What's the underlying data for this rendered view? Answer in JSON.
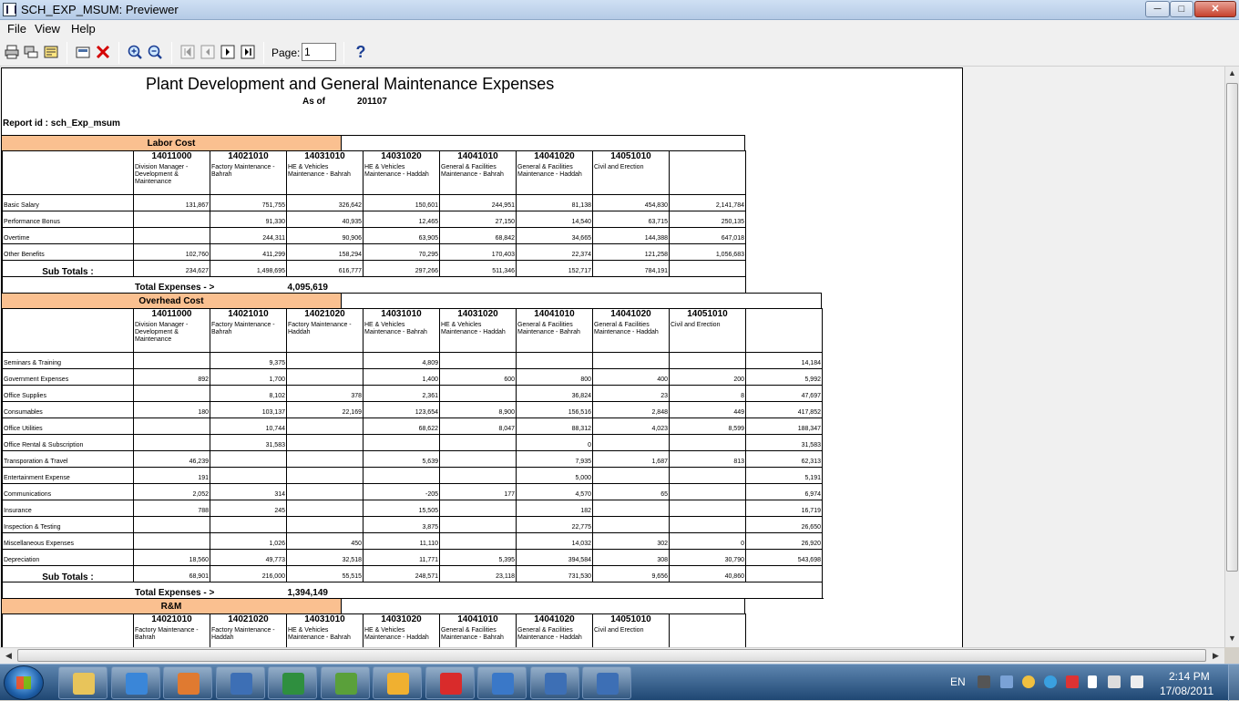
{
  "window": {
    "title": "SCH_EXP_MSUM: Previewer",
    "min": "─",
    "max": "□",
    "close": "✕"
  },
  "menu": [
    "File",
    "View",
    "Help"
  ],
  "toolbar": {
    "page_label": "Page:",
    "page_value": "1",
    "help": "?"
  },
  "icons": {
    "print": "printer-icon",
    "print_setup": "print-setup-icon",
    "export": "export-icon",
    "close_preview": "close-icon",
    "zoom_in": "zoom-in-icon",
    "zoom_out": "zoom-out-icon",
    "first": "first-page-icon",
    "prev": "prev-page-icon",
    "next": "next-page-icon",
    "last": "last-page-icon"
  },
  "report": {
    "title": "Plant Development and General Maintenance Expenses",
    "asof_label": "As of",
    "asof_value": "201107",
    "report_id": "Report id : sch_Exp_msum",
    "subtotal_label": "Sub Totals :",
    "total_label": "Total Expenses - >",
    "sections": [
      {
        "name": "Labor Cost",
        "columns": [
          {
            "code": "14011000",
            "desc": "Division Manager - Development & Maintenance"
          },
          {
            "code": "14021010",
            "desc": "Factory Maintenance - Bahrah"
          },
          {
            "code": "14031010",
            "desc": "HE & Vehicles Maintenance - Bahrah"
          },
          {
            "code": "14031020",
            "desc": "HE & Vehicles Maintenance - Haddah"
          },
          {
            "code": "14041010",
            "desc": "General & Facilities Maintenance - Bahrah"
          },
          {
            "code": "14041020",
            "desc": "General & Facilities Maintenance - Haddah"
          },
          {
            "code": "14051010",
            "desc": "Civil and Erection"
          },
          {
            "code": "",
            "desc": ""
          }
        ],
        "rows": [
          {
            "label": "Basic Salary",
            "values": [
              "131,867",
              "751,755",
              "326,642",
              "150,601",
              "244,951",
              "81,138",
              "454,830",
              "2,141,784"
            ]
          },
          {
            "label": "Performance Bonus",
            "values": [
              "",
              "91,330",
              "40,935",
              "12,465",
              "27,150",
              "14,540",
              "63,715",
              "250,135"
            ]
          },
          {
            "label": "Overtime",
            "values": [
              "",
              "244,311",
              "90,906",
              "63,905",
              "68,842",
              "34,665",
              "144,388",
              "647,018"
            ]
          },
          {
            "label": "Other Benefits",
            "values": [
              "102,760",
              "411,299",
              "158,294",
              "70,295",
              "170,403",
              "22,374",
              "121,258",
              "1,056,683"
            ]
          }
        ],
        "subtotals": [
          "234,627",
          "1,498,695",
          "616,777",
          "297,266",
          "511,346",
          "152,717",
          "784,191",
          ""
        ],
        "total": "4,095,619"
      },
      {
        "name": "Overhead Cost",
        "columns": [
          {
            "code": "14011000",
            "desc": "Division Manager - Development & Maintenance"
          },
          {
            "code": "14021010",
            "desc": "Factory Maintenance - Bahrah"
          },
          {
            "code": "14021020",
            "desc": "Factory Maintenance - Haddah"
          },
          {
            "code": "14031010",
            "desc": "HE & Vehicles Maintenance - Bahrah"
          },
          {
            "code": "14031020",
            "desc": "HE & Vehicles Maintenance - Haddah"
          },
          {
            "code": "14041010",
            "desc": "General & Facilities Maintenance - Bahrah"
          },
          {
            "code": "14041020",
            "desc": "General & Facilities Maintenance - Haddah"
          },
          {
            "code": "14051010",
            "desc": "Civil and Erection"
          },
          {
            "code": "",
            "desc": ""
          }
        ],
        "rows": [
          {
            "label": "Seminars & Training",
            "values": [
              "",
              "9,375",
              "",
              "4,809",
              "",
              "",
              "",
              "",
              "14,184"
            ]
          },
          {
            "label": "Government Expenses",
            "values": [
              "892",
              "1,700",
              "",
              "1,400",
              "600",
              "800",
              "400",
              "200",
              "5,992"
            ]
          },
          {
            "label": "Office Supplies",
            "values": [
              "",
              "8,102",
              "378",
              "2,361",
              "",
              "36,824",
              "23",
              "8",
              "47,697"
            ]
          },
          {
            "label": "Consumables",
            "values": [
              "180",
              "103,137",
              "22,169",
              "123,654",
              "8,900",
              "156,516",
              "2,848",
              "449",
              "417,852"
            ]
          },
          {
            "label": "Office Utilities",
            "values": [
              "",
              "10,744",
              "",
              "68,622",
              "8,047",
              "88,312",
              "4,023",
              "8,599",
              "188,347"
            ]
          },
          {
            "label": "Office Rental & Subscription",
            "values": [
              "",
              "31,583",
              "",
              "",
              "",
              "0",
              "",
              "",
              "31,583"
            ]
          },
          {
            "label": "Transporation & Travel",
            "values": [
              "46,239",
              "",
              "",
              "5,639",
              "",
              "7,935",
              "1,687",
              "813",
              "62,313"
            ]
          },
          {
            "label": "Entertainment Expense",
            "values": [
              "191",
              "",
              "",
              "",
              "",
              "5,000",
              "",
              "",
              "5,191"
            ]
          },
          {
            "label": "Communications",
            "values": [
              "2,052",
              "314",
              "",
              "-205",
              "177",
              "4,570",
              "65",
              "",
              "6,974"
            ]
          },
          {
            "label": "Insurance",
            "values": [
              "788",
              "245",
              "",
              "15,505",
              "",
              "182",
              "",
              "",
              "16,719"
            ]
          },
          {
            "label": "Inspection & Testing",
            "values": [
              "",
              "",
              "",
              "3,875",
              "",
              "22,775",
              "",
              "",
              "26,650"
            ]
          },
          {
            "label": "Miscellaneous Expenses",
            "values": [
              "",
              "1,026",
              "450",
              "11,110",
              "",
              "14,032",
              "302",
              "0",
              "26,920"
            ]
          },
          {
            "label": "Depreciation",
            "values": [
              "18,560",
              "49,773",
              "32,518",
              "11,771",
              "5,395",
              "394,584",
              "308",
              "30,790",
              "543,698"
            ]
          }
        ],
        "subtotals": [
          "68,901",
          "216,000",
          "55,515",
          "248,571",
          "23,118",
          "731,530",
          "9,656",
          "40,860",
          ""
        ],
        "total": "1,394,149"
      },
      {
        "name": "R&M",
        "columns": [
          {
            "code": "14021010",
            "desc": "Factory Maintenance - Bahrah"
          },
          {
            "code": "14021020",
            "desc": "Factory Maintenance - Haddah"
          },
          {
            "code": "14031010",
            "desc": "HE & Vehicles Maintenance - Bahrah"
          },
          {
            "code": "14031020",
            "desc": "HE & Vehicles Maintenance - Haddah"
          },
          {
            "code": "14041010",
            "desc": "General & Facilities Maintenance - Bahrah"
          },
          {
            "code": "14041020",
            "desc": "General & Facilities Maintenance - Haddah"
          },
          {
            "code": "14051010",
            "desc": "Civil and Erection"
          },
          {
            "code": "",
            "desc": ""
          }
        ],
        "rows": [],
        "subtotals": [],
        "total": ""
      }
    ]
  },
  "taskbar": {
    "apps": [
      "folder-icon",
      "ie-icon",
      "media-player-icon",
      "report-icon",
      "excel-icon",
      "frog-icon",
      "outlook-icon",
      "pdf-icon",
      "previewer-icon",
      "calc-icon",
      "scheduler-icon"
    ],
    "language": "EN",
    "time": "2:14 PM",
    "date": "17/08/2011"
  },
  "colors": {
    "band": "#fac090",
    "taskbar": "#1f4773",
    "close": "#c7412c"
  }
}
